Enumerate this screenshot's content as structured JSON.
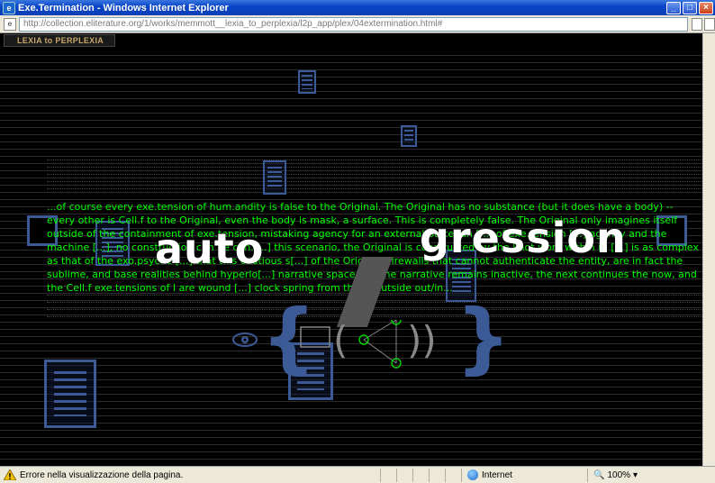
{
  "window": {
    "title": "Exe.Termination - Windows Internet Explorer",
    "minimize_glyph": "_",
    "maximize_glyph": "□",
    "close_glyph": "×"
  },
  "address": {
    "url": "http://collection.eliterature.org/1/works/memmott__lexia_to_perplexia/l2p_app/plex/04extermination.html#"
  },
  "content": {
    "tab_label": "LEXIA to PERPLEXIA",
    "paragraph": "...of course every exe.tension of hum.andity is false to the Original. The Original has no substance (but it does have a body) -- every other is Cell.f to the Original, even the body is mask, a surface. This is completely false. The Original only imagines itself outside of the containment of exe.tension, mistaking agency for an external State, an [...] of exe.tension [...] agency and the machine [...], no construction can be con.[...] this scenario, the Original is constructed by the knot.work within it, [...] is as complex as that of the exo.psyche [...] that this cautious s[...] of the Original, firewalls that cannot authenticate the entity, are in fact the sublime, and base realities behind hyperlo[...] narrative space. So, the narrative remains inactive, the next continues the now, and the Cell.f exe.tensions of I are wound [...] clock spring from the in/outside out/in...",
    "word_left": "auto",
    "word_right": "gression",
    "brace_open": "{",
    "brace_close": "}",
    "paren_open": "(",
    "paren_close": "))"
  },
  "statusbar": {
    "message": "Errore nella visualizzazione della pagina.",
    "zone": "Internet",
    "zoom": "100%"
  },
  "colors": {
    "accent_blue": "#3b5a96",
    "text_green": "#00ff00",
    "tab_gold": "#c8a76a"
  }
}
